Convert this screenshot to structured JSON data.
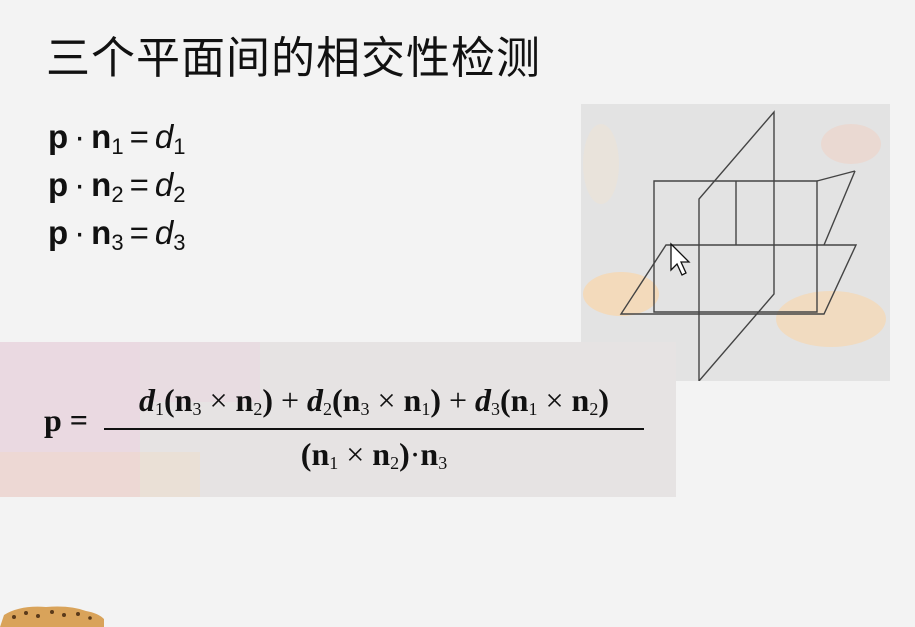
{
  "slide": {
    "title": "三个平面间的相交性检测",
    "equations": [
      {
        "p": "p",
        "dot": "·",
        "n": "n",
        "n_sub": "1",
        "eq": "=",
        "d": "d",
        "d_sub": "1"
      },
      {
        "p": "p",
        "dot": "·",
        "n": "n",
        "n_sub": "2",
        "eq": "=",
        "d": "d",
        "d_sub": "2"
      },
      {
        "p": "p",
        "dot": "·",
        "n": "n",
        "n_sub": "3",
        "eq": "=",
        "d": "d",
        "d_sub": "3"
      }
    ],
    "formula": {
      "lhs": "p =",
      "numerator": {
        "t1": {
          "d": "d",
          "d_sub": "1",
          "a": "n",
          "a_sub": "3",
          "b": "n",
          "b_sub": "2"
        },
        "t2": {
          "d": "d",
          "d_sub": "2",
          "a": "n",
          "a_sub": "3",
          "b": "n",
          "b_sub": "1"
        },
        "t3": {
          "d": "d",
          "d_sub": "3",
          "a": "n",
          "a_sub": "1",
          "b": "n",
          "b_sub": "2"
        }
      },
      "denominator": {
        "a": "n",
        "a_sub": "1",
        "b": "n",
        "b_sub": "2",
        "c": "n",
        "c_sub": "3"
      }
    }
  },
  "colors": {
    "background": "#f3f3f3",
    "text": "#111111",
    "figure_bg": "#e3e3e3",
    "formula_bg": "#e6e3e3",
    "accent_pink": "#f1c6dc",
    "accent_orange": "#f6d7b0"
  },
  "icons": [
    "cursor-arrow-icon",
    "cheetah-icon"
  ]
}
